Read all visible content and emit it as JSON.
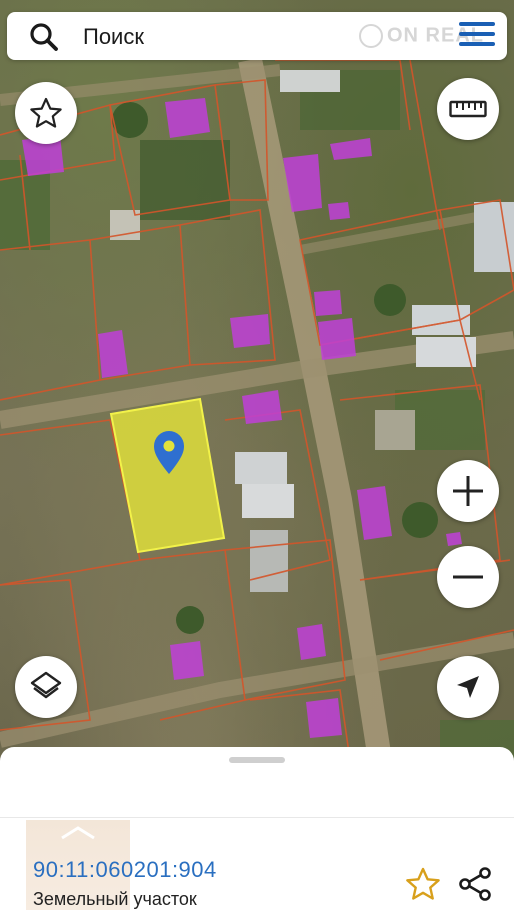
{
  "search": {
    "placeholder": "Поиск",
    "watermark": "ON REAL"
  },
  "colors": {
    "accent": "#1a5fb4",
    "link": "#2a6fc0",
    "parcel_selected": "#e2e23a",
    "building_overlay": "#c040d8",
    "boundary": "#d4552a"
  },
  "map_buttons": {
    "favorite": "star-outline-icon",
    "ruler": "ruler-icon",
    "zoom_in": "+",
    "zoom_out": "−",
    "layers": "layers-icon",
    "locate": "navigation-arrow-icon"
  },
  "parcel": {
    "cadastral_number": "90:11:060201:904",
    "type": "Земельный участок"
  }
}
